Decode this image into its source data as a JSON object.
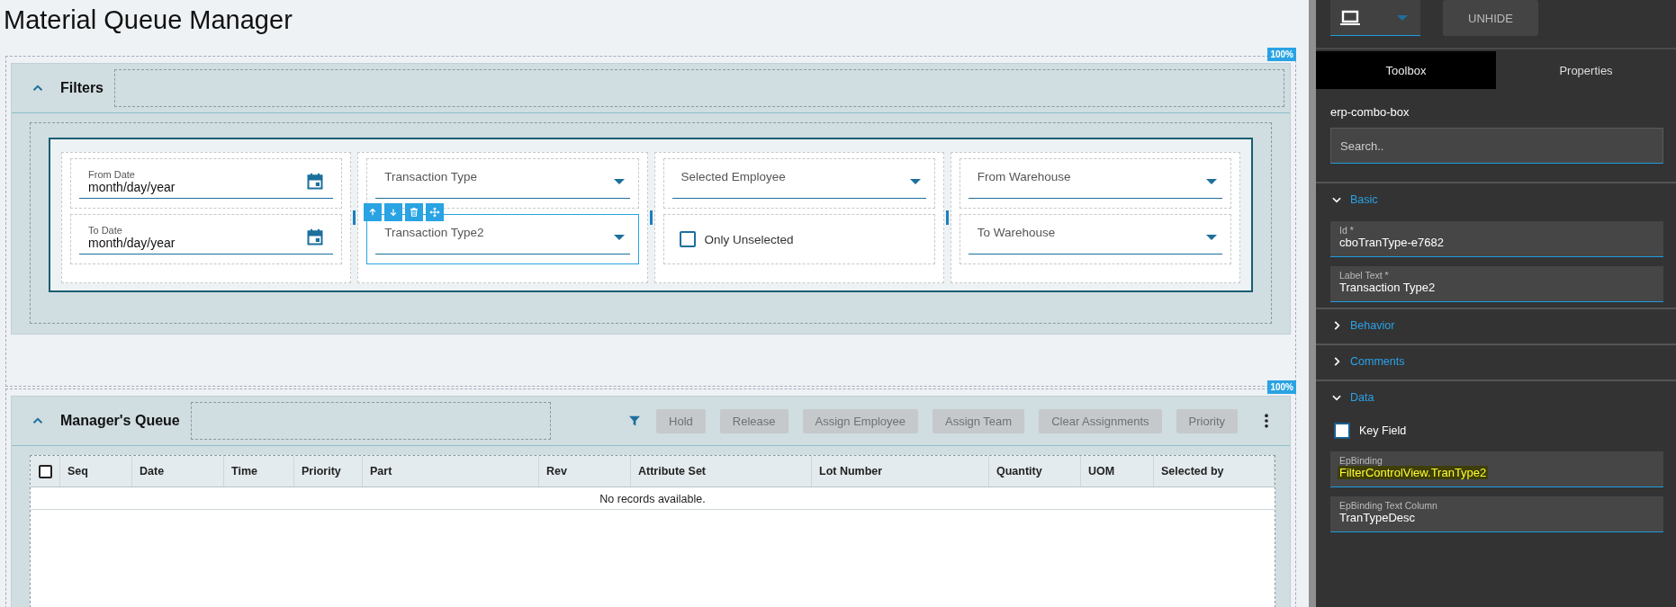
{
  "page_title": "Material Queue Manager",
  "filters": {
    "badge": "100%",
    "title": "Filters",
    "expanded": true,
    "columns": [
      {
        "fields": [
          {
            "kind": "date",
            "label": "From Date",
            "value": "month/day/year",
            "selected": false
          },
          {
            "kind": "date",
            "label": "To Date",
            "value": "month/day/year",
            "selected": false
          }
        ]
      },
      {
        "fields": [
          {
            "kind": "combo",
            "label": "Transaction Type",
            "selected": false
          },
          {
            "kind": "combo",
            "label": "Transaction Type2",
            "selected": true
          }
        ]
      },
      {
        "fields": [
          {
            "kind": "combo",
            "label": "Selected Employee",
            "selected": false
          },
          {
            "kind": "checkbox",
            "label": "Only Unselected",
            "checked": false,
            "selected": false
          }
        ]
      },
      {
        "fields": [
          {
            "kind": "combo",
            "label": "From Warehouse",
            "selected": false
          },
          {
            "kind": "combo",
            "label": "To Warehouse",
            "selected": false
          }
        ]
      }
    ]
  },
  "queue": {
    "badge": "100%",
    "title": "Manager's Queue",
    "expanded": true,
    "buttons": [
      {
        "label": "Hold",
        "disabled": true
      },
      {
        "label": "Release",
        "disabled": true
      },
      {
        "label": "Assign Employee",
        "disabled": true
      },
      {
        "label": "Assign Team",
        "disabled": true
      },
      {
        "label": "Clear Assignments",
        "disabled": true
      },
      {
        "label": "Priority",
        "disabled": true
      }
    ],
    "select_all": {
      "checked": false
    },
    "columns": [
      "Seq",
      "Date",
      "Time",
      "Priority",
      "Part",
      "Rev",
      "Attribute Set",
      "Lot Number",
      "Quantity",
      "UOM",
      "Selected by"
    ],
    "empty_message": "No records available."
  },
  "designer": {
    "unhide": "UNHIDE",
    "tabs": [
      {
        "label": "Toolbox",
        "selected": true
      },
      {
        "label": "Properties",
        "selected": false
      }
    ],
    "component": "erp-combo-box",
    "search": {
      "placeholder": "Search.."
    },
    "sections": [
      {
        "title": "Basic",
        "expanded": true,
        "items": [
          {
            "kind": "field",
            "label": "Id *",
            "value": "cboTranType-e7682",
            "highlighted": false
          },
          {
            "kind": "field",
            "label": "Label Text *",
            "value": "Transaction Type2",
            "highlighted": false
          }
        ]
      },
      {
        "title": "Behavior",
        "expanded": false
      },
      {
        "title": "Comments",
        "expanded": false
      },
      {
        "title": "Data",
        "expanded": true,
        "items": [
          {
            "kind": "checkbox",
            "label": "Key Field",
            "checked": false
          },
          {
            "kind": "field",
            "label": "EpBinding",
            "value": "FilterControlView.TranType2",
            "highlighted": true
          },
          {
            "kind": "field",
            "label": "EpBinding Text Column",
            "value": "TranTypeDesc",
            "highlighted": false
          }
        ]
      }
    ]
  }
}
